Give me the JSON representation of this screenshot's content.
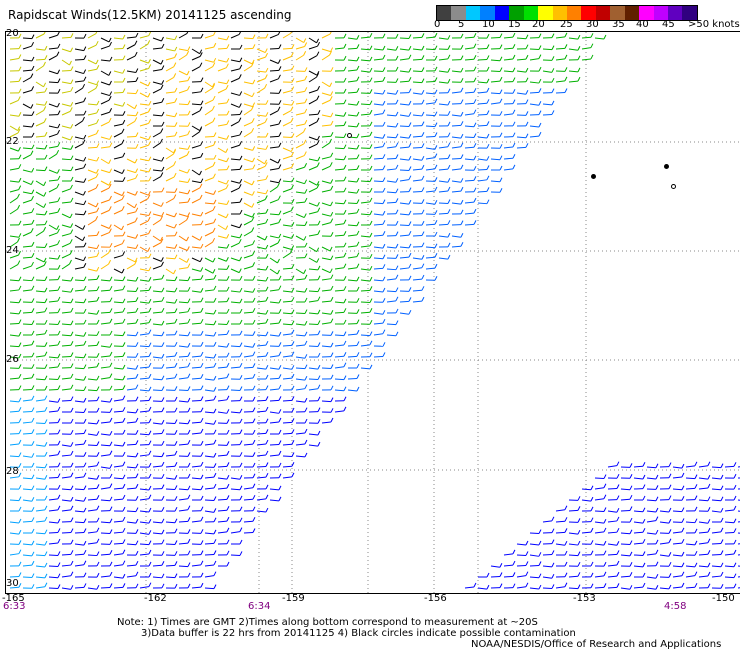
{
  "title": "Rapidscat Winds(12.5KM) 20141125 ascending",
  "legend": {
    "colors": [
      "#404040",
      "#8c8c8c",
      "#00c8ff",
      "#0080ff",
      "#0000ff",
      "#00a000",
      "#00e000",
      "#ffff00",
      "#ffc000",
      "#ff8000",
      "#ff0000",
      "#c00000",
      "#a06030",
      "#602000",
      "#ff00ff",
      "#c000ff",
      "#6000c0",
      "#300080"
    ],
    "labels": [
      "0",
      "5",
      "10",
      "15",
      "20",
      "25",
      "30",
      "35",
      "40",
      "45",
      ">50 knots"
    ]
  },
  "axes": {
    "lat_labels": [
      "20",
      "22",
      "24",
      "26",
      "28",
      "30"
    ],
    "lon_labels": [
      "-165",
      "-162",
      "-159",
      "-156",
      "-153",
      "-150"
    ]
  },
  "times": {
    "left": "6:33",
    "mid": "6:34",
    "right": "4:58"
  },
  "notes": {
    "line1": "Note: 1) Times are GMT 2)Times along bottom correspond to measurement at ~20S",
    "line2": "3)Data buffer is 22 hrs from 20141125 4) Black circles indicate possible contamination",
    "credit": "NOAA/NESDIS/Office of Research and Applications"
  }
}
